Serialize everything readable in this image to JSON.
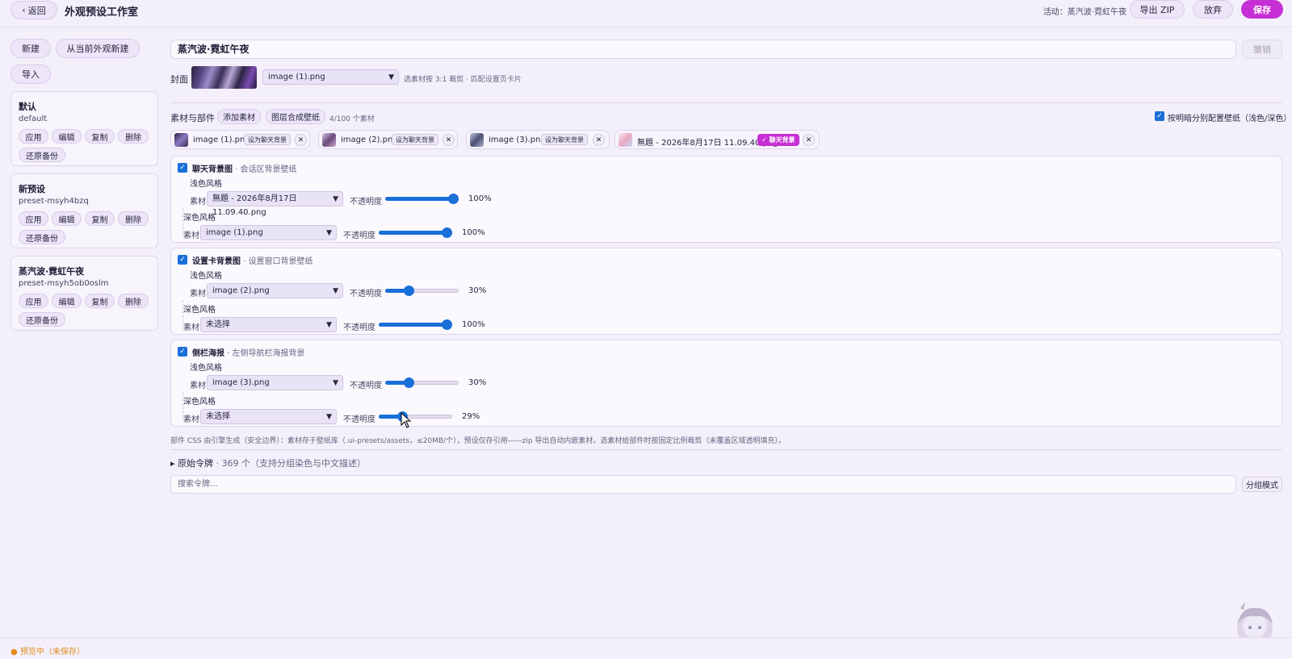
{
  "header": {
    "back_label": "返回",
    "back_icon": "‹",
    "title": "外观预设工作室",
    "active_label": "活动：蒸汽波·霓虹午夜",
    "export_label": "导出 ZIP",
    "discard_label": "放弃",
    "save_label": "保存"
  },
  "sidebar": {
    "new_label": "新建",
    "new_from_current_label": "从当前外观新建",
    "import_label": "导入",
    "presets": [
      {
        "name": "默认",
        "id": "default",
        "apply": "应用",
        "edit": "编辑",
        "copy": "复制",
        "delete": "删除",
        "restore": "还原备份"
      },
      {
        "name": "新预设",
        "id": "preset-msyh4bzq",
        "apply": "应用",
        "edit": "编辑",
        "copy": "复制",
        "delete": "删除",
        "restore": "还原备份"
      },
      {
        "name": "蒸汽波·霓虹午夜",
        "id": "preset-msyh5ob0oslm",
        "apply": "应用",
        "edit": "编辑",
        "copy": "复制",
        "delete": "删除",
        "restore": "还原备份"
      }
    ]
  },
  "editor": {
    "preset_name": "蒸汽波·霓虹午夜",
    "undo_label": "撤销",
    "cover_label": "封面",
    "cover_select": "image (1).png",
    "cover_hint": "选素材按 3:1 裁剪 · 匹配设置页卡片",
    "assets_label": "素材与部件",
    "add_asset_label": "添加素材",
    "compose_label": "图层合成壁纸",
    "asset_count": "4/100 个素材",
    "light_dark_label": "按明暗分别配置壁纸（浅色/深色）",
    "assets": [
      {
        "name": "image (1).png",
        "action": "设为聊天背景",
        "active": false
      },
      {
        "name": "image (2).png",
        "action": "设为聊天背景",
        "active": false
      },
      {
        "name": "image (3).png",
        "action": "设为聊天背景",
        "active": false
      },
      {
        "name": "無題 - 2026年8月17日 11.09.40.png",
        "action": "✓ 聊天背景",
        "active": true
      }
    ],
    "close_icon": "✕",
    "check_icon": "✓",
    "layers": [
      {
        "title": "聊天背景图",
        "desc": " · 会话区背景壁纸",
        "light_label": "浅色风格",
        "dark_label": "深色风格",
        "asset_label": "素材",
        "opacity_label": "不透明度",
        "light_asset": "無題 - 2026年8月17日 11.09.40.png",
        "light_opacity": 100,
        "light_pct": "100%",
        "dark_asset": "image (1).png",
        "dark_opacity": 100,
        "dark_pct": "100%"
      },
      {
        "title": "设置卡背景图",
        "desc": " · 设置窗口背景壁纸",
        "light_label": "浅色风格",
        "dark_label": "深色风格",
        "asset_label": "素材",
        "opacity_label": "不透明度",
        "light_asset": "image (2).png",
        "light_opacity": 30,
        "light_pct": "30%",
        "dark_asset": "未选择",
        "dark_opacity": 100,
        "dark_pct": "100%"
      },
      {
        "title": "侧栏海报",
        "desc": " · 左侧导航栏海报背景",
        "light_label": "浅色风格",
        "dark_label": "深色风格",
        "asset_label": "素材",
        "opacity_label": "不透明度",
        "light_asset": "image (3).png",
        "light_opacity": 30,
        "light_pct": "30%",
        "dark_asset": "未选择",
        "dark_opacity": 29,
        "dark_pct": "29%"
      }
    ],
    "footnote": "部件 CSS 由引擎生成（安全边界）：素材存于壁纸库（.ui-presets/assets，≤20MB/个），预设仅存引用——zip 导出自动内嵌素材。选素材给部件时按固定比例裁剪（未覆盖区域透明填充）。",
    "raw_tokens_label": "原始令牌",
    "raw_tokens_caret": "▸",
    "raw_tokens_sub": " · 369 个（支持分组染色与中文描述）",
    "search_placeholder": "搜索令牌...",
    "group_mode_label": "分组模式"
  },
  "status": {
    "text": "● 预览中（未保存）"
  },
  "colors": {
    "accent": "#c62fd4",
    "primary": "#1a6fd9",
    "warning": "#e08a1c",
    "background": "#f4f0fb"
  }
}
